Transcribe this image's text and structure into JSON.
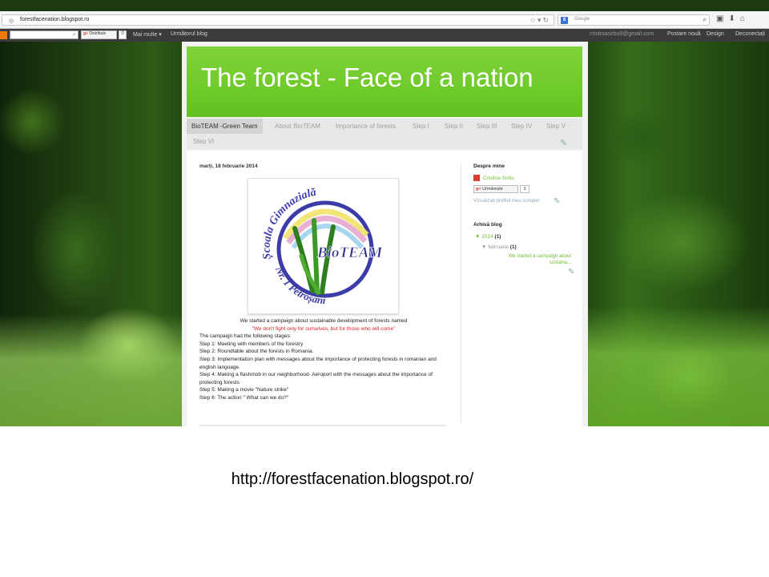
{
  "browser": {
    "url": "forestfacenation.blogspot.ro",
    "search_placeholder": "Google"
  },
  "navbar": {
    "g1_label": "Distribuie",
    "g1_count": "0",
    "more": "Mai multe ▾",
    "next_blog": "Următorul blog",
    "email": "cristinasirbu9@gmail.com",
    "new_post": "Postare nouă",
    "design": "Design",
    "logout": "Deconectați"
  },
  "blog": {
    "title": "The forest - Face of a nation",
    "tabs": [
      "BioTEAM -Green Team",
      "About BioTEAM",
      "Importance of forests",
      "Step I",
      "Step II",
      "Step III",
      "Step IV",
      "Step V",
      "Step VI"
    ],
    "post": {
      "date": "marți, 18 februarie 2014",
      "logo_top_text": "Școala Gimnazială",
      "logo_center_text": "BioTEAM",
      "logo_bottom_text": "Nr. 1 Petroșani",
      "lines": [
        "We started a campaign about sustainable development of forests named",
        "\"We don't fight only for ourselves, but for those who will come\"",
        "The campaign had the following stages:",
        "Step 1:  Meeting with members of the forestry",
        "Step 2:  Roundtable about the forests in Romania.",
        "Step 3: Implementation plan with messages about the importance of protecting forests in romanian and english language.",
        "Step 4:  Making a flashmob in our neighborhood- Aeroport with the messages about the importance of protecting forests",
        "Step 5:  Making a movie  \"Nature  strike\"",
        "Step 6:  The action \" What can we do?\""
      ]
    },
    "sidebar": {
      "about_heading": "Despre mine",
      "profile_name": "Cristina Sirbu",
      "follow_label": "Urmărește",
      "follow_count": "3",
      "profile_link": "Vizualizați profilul meu complet",
      "archive_heading": "Arhivă blog",
      "archive_year": "2014",
      "archive_year_count": "(1)",
      "archive_month": "februarie",
      "archive_month_count": "(1)",
      "archive_post": "We started a campaign about sustaina..."
    }
  },
  "caption": "http://forestfacenation.blogspot.ro/",
  "colors": {
    "header_green": "#6fca2b",
    "accent_green": "#6fbd2f",
    "quote_red": "#e02424",
    "navbar_dark": "#3b3b3b"
  }
}
